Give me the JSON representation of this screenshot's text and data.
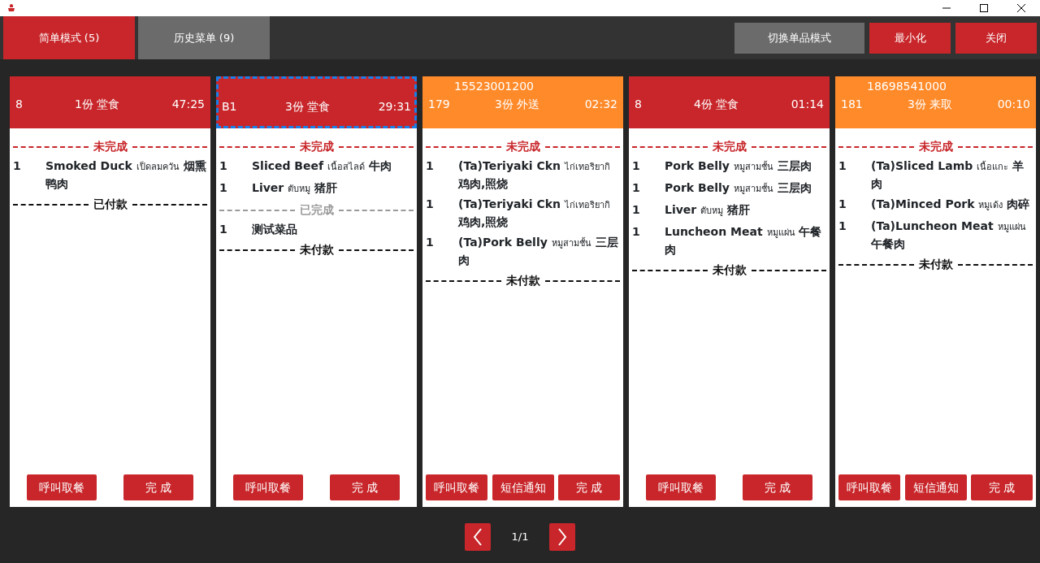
{
  "tabs": [
    {
      "label": "简单模式 (5)",
      "selected": true
    },
    {
      "label": "历史菜单 (9)",
      "selected": false
    }
  ],
  "actions": [
    {
      "label": "切换单品模式",
      "kind": "secondary"
    },
    {
      "label": "最小化",
      "kind": "primary"
    },
    {
      "label": "关闭",
      "kind": "primary"
    }
  ],
  "orders": [
    {
      "number": "8",
      "summary": "1份 堂食",
      "time": "47:25",
      "kind": "dine_in",
      "selected": false,
      "sections": [
        {
          "label": "未完成",
          "kind": "pending",
          "items": [
            {
              "qty": "1",
              "name_en": "Smoked Duck",
              "name_th": "เป็ดลมควัน",
              "name_zh": "烟熏鸭肉"
            }
          ]
        },
        {
          "label": "已付款",
          "kind": "payment"
        }
      ],
      "buttons": [
        "呼叫取餐",
        "完 成"
      ]
    },
    {
      "number": "B1",
      "summary": "3份 堂食",
      "time": "29:31",
      "kind": "dine_in",
      "selected": true,
      "sections": [
        {
          "label": "未完成",
          "kind": "pending",
          "items": [
            {
              "qty": "1",
              "name_en": "Sliced Beef",
              "name_th": "เนื้อสไลด์",
              "name_zh": "牛肉"
            },
            {
              "qty": "1",
              "name_en": "Liver",
              "name_th": "ตับหมู",
              "name_zh": "猪肝"
            }
          ]
        },
        {
          "label": "已完成",
          "kind": "done",
          "items": [
            {
              "qty": "1",
              "name_zh": "测试菜品"
            }
          ]
        },
        {
          "label": "未付款",
          "kind": "payment"
        }
      ],
      "buttons": [
        "呼叫取餐",
        "完 成"
      ]
    },
    {
      "phone": "15523001200",
      "number": "179",
      "summary": "3份 外送",
      "time": "02:32",
      "kind": "delivery",
      "selected": false,
      "sections": [
        {
          "label": "未完成",
          "kind": "pending",
          "items": [
            {
              "qty": "1",
              "name_en": "(Ta)Teriyaki Ckn",
              "name_th": "ไก่เทอริยากิ",
              "name_zh": "鸡肉,照烧"
            },
            {
              "qty": "1",
              "name_en": "(Ta)Teriyaki Ckn",
              "name_th": "ไก่เทอริยากิ",
              "name_zh": "鸡肉,照烧"
            },
            {
              "qty": "1",
              "name_en": "(Ta)Pork Belly",
              "name_th": "หมูสามชั้น",
              "name_zh": "三层肉"
            }
          ]
        },
        {
          "label": "未付款",
          "kind": "payment"
        }
      ],
      "buttons": [
        "呼叫取餐",
        "短信通知",
        "完 成"
      ]
    },
    {
      "number": "8",
      "summary": "4份 堂食",
      "time": "01:14",
      "kind": "dine_in",
      "selected": false,
      "sections": [
        {
          "label": "未完成",
          "kind": "pending",
          "items": [
            {
              "qty": "1",
              "name_en": "Pork Belly",
              "name_th": "หมูสามชั้น",
              "name_zh": "三层肉"
            },
            {
              "qty": "1",
              "name_en": "Pork Belly",
              "name_th": "หมูสามชั้น",
              "name_zh": "三层肉"
            },
            {
              "qty": "1",
              "name_en": "Liver",
              "name_th": "ตับหมู",
              "name_zh": "猪肝"
            },
            {
              "qty": "1",
              "name_en": "Luncheon Meat",
              "name_th": "หมูแผ่น",
              "name_zh": "午餐肉"
            }
          ]
        },
        {
          "label": "未付款",
          "kind": "payment"
        }
      ],
      "buttons": [
        "呼叫取餐",
        "完 成"
      ]
    },
    {
      "phone": "18698541000",
      "number": "181",
      "summary": "3份 来取",
      "time": "00:10",
      "kind": "pickup",
      "selected": false,
      "sections": [
        {
          "label": "未完成",
          "kind": "pending",
          "items": [
            {
              "qty": "1",
              "name_en": "(Ta)Sliced Lamb",
              "name_th": "เนื้อแกะ",
              "name_zh": "羊肉"
            },
            {
              "qty": "1",
              "name_en": "(Ta)Minced Pork",
              "name_th": "หมูเด้ง",
              "name_zh": "肉碎"
            },
            {
              "qty": "1",
              "name_en": "(Ta)Luncheon Meat",
              "name_th": "หมูแผ่น",
              "name_zh": "午餐肉"
            }
          ]
        },
        {
          "label": "未付款",
          "kind": "payment"
        }
      ],
      "buttons": [
        "呼叫取餐",
        "短信通知",
        "完 成"
      ]
    }
  ],
  "pager": {
    "label": "1/1"
  }
}
